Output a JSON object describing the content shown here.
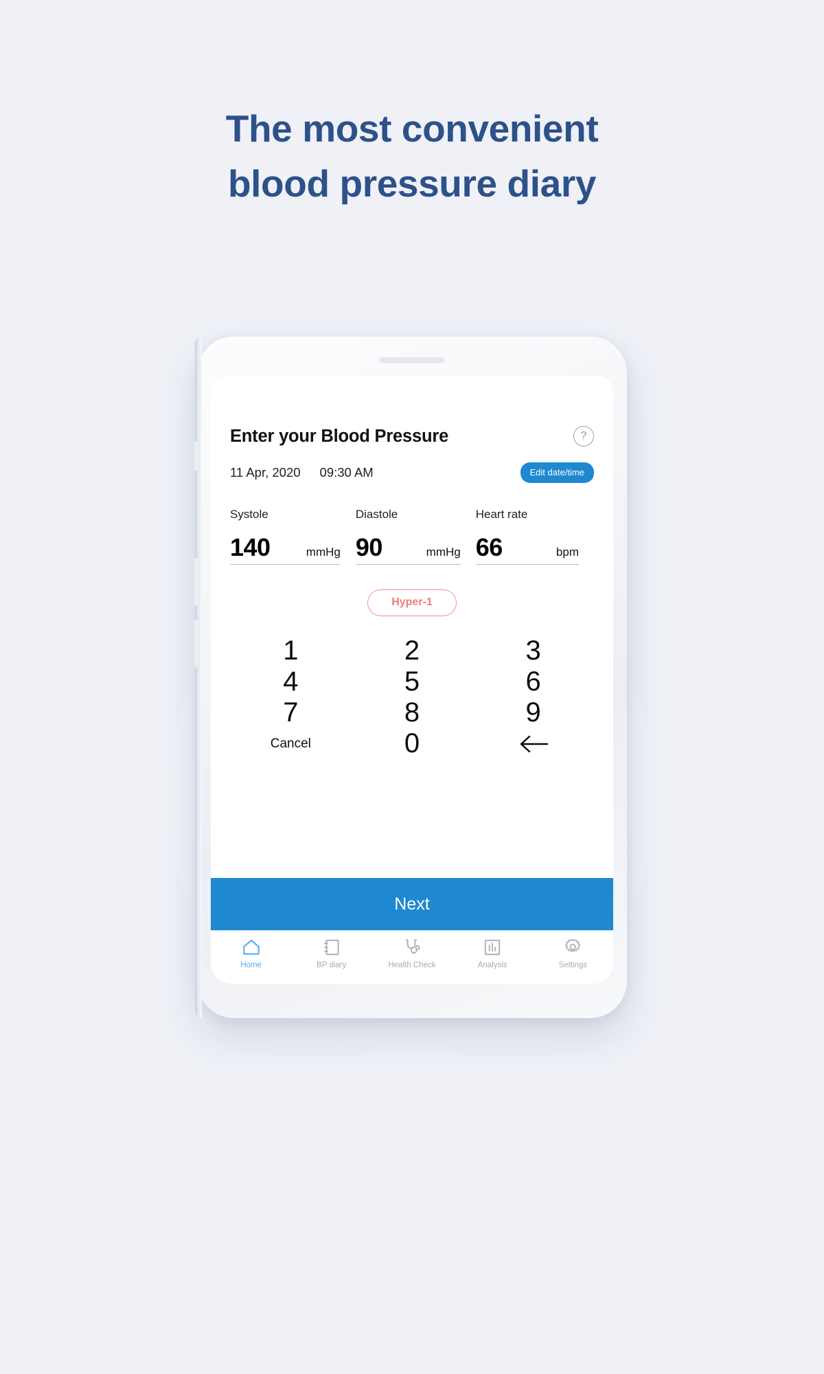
{
  "page": {
    "background_color": "#eff1f7",
    "headline_color": "#2d5189",
    "accent_color": "#1e88d0",
    "alert_color": "#ea7f7d"
  },
  "headline": {
    "line1": "The most convenient",
    "line2": "blood pressure diary"
  },
  "app": {
    "title": "Enter your Blood Pressure",
    "help_icon": "question-mark-circle-icon",
    "date": "11 Apr, 2020",
    "time": "09:30 AM",
    "edit_button": "Edit date/time",
    "fields": [
      {
        "label": "Systole",
        "value": "140",
        "unit": "mmHg"
      },
      {
        "label": "Diastole",
        "value": "90",
        "unit": "mmHg"
      },
      {
        "label": "Heart rate",
        "value": "66",
        "unit": "bpm"
      }
    ],
    "classification": "Hyper-1",
    "keypad": [
      "1",
      "2",
      "3",
      "4",
      "5",
      "6",
      "7",
      "8",
      "9",
      "Cancel",
      "0",
      "backspace-icon"
    ],
    "next_button": "Next",
    "nav": [
      {
        "label": "Home",
        "icon": "home-icon",
        "active": true
      },
      {
        "label": "BP diary",
        "icon": "notebook-icon",
        "active": false
      },
      {
        "label": "Health Check",
        "icon": "stethoscope-icon",
        "active": false
      },
      {
        "label": "Analysis",
        "icon": "bar-chart-icon",
        "active": false
      },
      {
        "label": "Settings",
        "icon": "gear-icon",
        "active": false
      }
    ]
  }
}
